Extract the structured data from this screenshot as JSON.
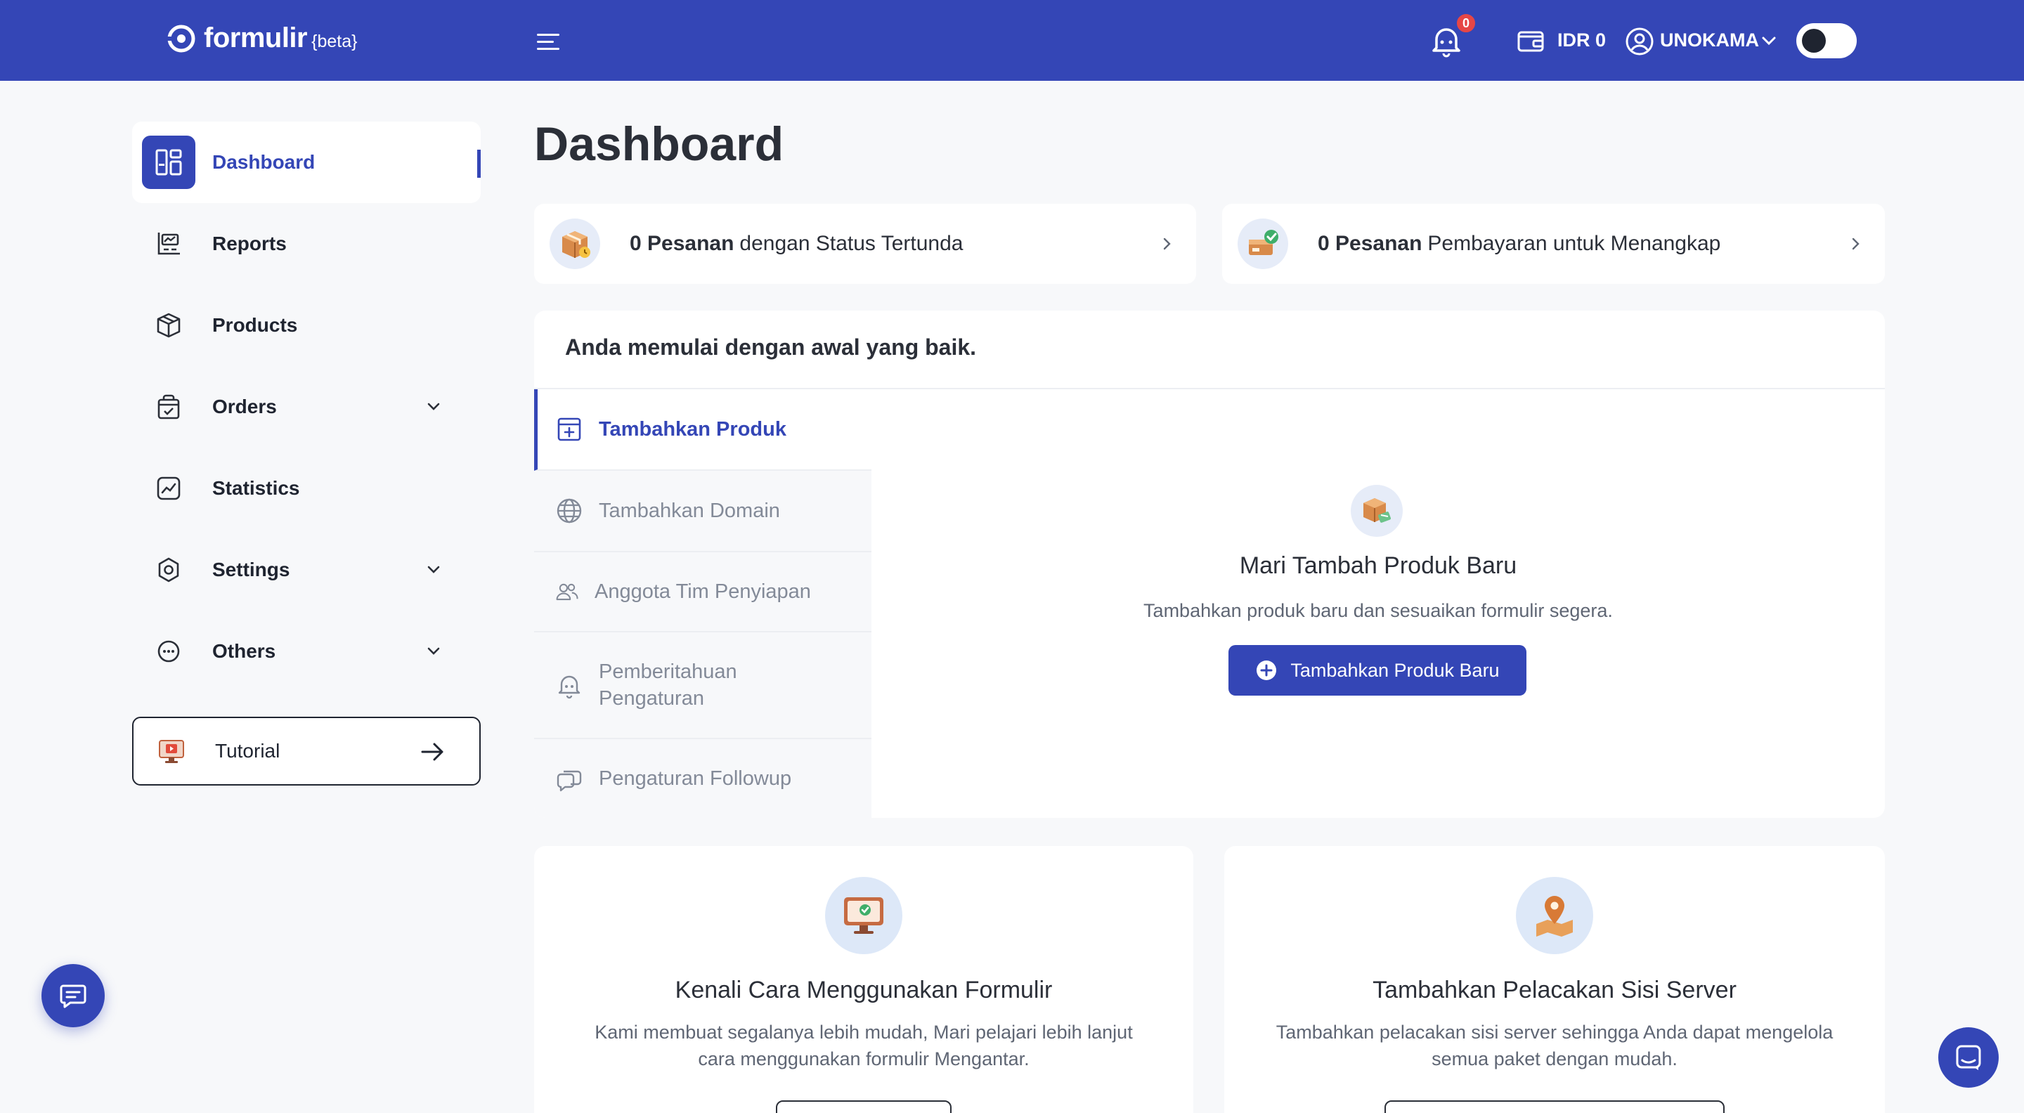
{
  "header": {
    "brand": "formulir",
    "brand_tag": "{beta}",
    "notification_count": "0",
    "balance": "IDR 0",
    "username": "UNOKAMA"
  },
  "sidebar": {
    "items": [
      {
        "label": "Dashboard",
        "icon": "dashboard-icon",
        "active": true
      },
      {
        "label": "Reports",
        "icon": "reports-icon"
      },
      {
        "label": "Products",
        "icon": "box-icon"
      },
      {
        "label": "Orders",
        "icon": "bag-icon",
        "expandable": true
      },
      {
        "label": "Statistics",
        "icon": "chart-icon"
      },
      {
        "label": "Settings",
        "icon": "gear-icon",
        "expandable": true
      },
      {
        "label": "Others",
        "icon": "dots-icon",
        "expandable": true
      }
    ],
    "tutorial_label": "Tutorial"
  },
  "main": {
    "title": "Dashboard",
    "stats": [
      {
        "count": "0 Pesanan",
        "text": "dengan Status Tertunda"
      },
      {
        "count": "0 Pesanan",
        "text": "Pembayaran untuk Menangkap"
      }
    ],
    "start": {
      "title": "Anda memulai dengan awal yang baik.",
      "tabs": [
        {
          "label": "Tambahkan Produk",
          "icon": "add-box-icon"
        },
        {
          "label": "Tambahkan Domain",
          "icon": "globe-icon"
        },
        {
          "label": "Anggota Tim Penyiapan",
          "icon": "team-icon"
        },
        {
          "label": "Pemberitahuan Pengaturan",
          "icon": "bell-icon"
        },
        {
          "label": "Pengaturan Followup",
          "icon": "chat-icon"
        }
      ],
      "content": {
        "title": "Mari Tambah Produk Baru",
        "description": "Tambahkan produk baru dan sesuaikan formulir segera.",
        "button": "Tambahkan Produk Baru"
      }
    },
    "cards": [
      {
        "title": "Kenali Cara Menggunakan Formulir",
        "description": "Kami membuat segalanya lebih mudah, Mari pelajari lebih lanjut cara menggunakan formulir Mengantar."
      },
      {
        "title": "Tambahkan Pelacakan Sisi Server",
        "description": "Tambahkan pelacakan sisi server sehingga Anda dapat mengelola semua paket dengan mudah."
      }
    ]
  },
  "colors": {
    "primary": "#3446b6",
    "background": "#f7f8fa",
    "badge": "#e64646"
  }
}
